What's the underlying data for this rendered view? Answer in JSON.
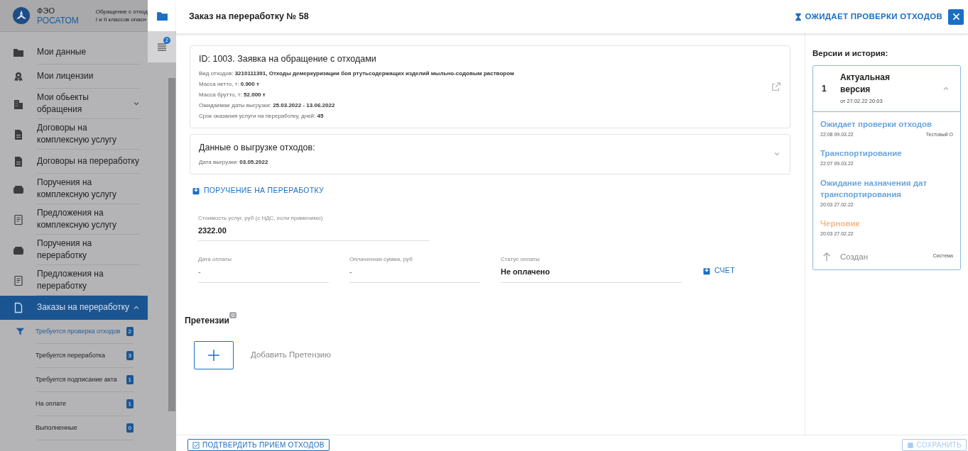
{
  "sidebar": {
    "brand": {
      "line1": "ФЭО",
      "line2": "РОСАТОМ"
    },
    "app_title": [
      "Обращение с отход",
      "I и II классов опасн"
    ],
    "items": [
      {
        "label": "Мои данные",
        "selected": false
      },
      {
        "label": "Мои лицензии",
        "selected": false
      },
      {
        "label": "Мои обьекты обращения",
        "selected": false,
        "expanded": false
      },
      {
        "label": "Договоры на комплексную услугу",
        "selected": false
      },
      {
        "label": "Договоры на переработку",
        "selected": false
      },
      {
        "label": "Поручения на комплексную услугу",
        "selected": false
      },
      {
        "label": "Предложения на комплексную услугу",
        "selected": false
      },
      {
        "label": "Поручения на переработку",
        "selected": false
      },
      {
        "label": "Предложения на переработку",
        "selected": false
      },
      {
        "label": "Заказы на переработку",
        "selected": true,
        "expanded": true,
        "children": [
          {
            "label": "Требуется проверка отходов",
            "count": "2",
            "selected": true
          },
          {
            "label": "Требуется переработка",
            "count": "3",
            "selected": false
          },
          {
            "label": "Требуется подписание акта",
            "count": "1",
            "selected": false
          },
          {
            "label": "На оплате",
            "count": "1",
            "selected": false
          },
          {
            "label": "Выполненные",
            "count": "0",
            "selected": false
          }
        ]
      }
    ]
  },
  "side_tabs": [
    {
      "kind": "folder",
      "selected": true
    },
    {
      "kind": "list",
      "badge": "2",
      "selected": false
    }
  ],
  "header": {
    "title": "Заказ на переработку № 58",
    "status": "ОЖИДАЕТ ПРОВЕРКИ ОТХОДОВ"
  },
  "request_card": {
    "title": "ID: 1003. Заявка на обращение с отходами",
    "lines": [
      "Вид отходов: **3210111391, Отходы демеркуризации боя ртутьсодержащих изделий мыльно-содовым раствором**",
      "Масса нетто, т: **0.900 т**",
      "Масса брутто, т: **52.000 т**",
      "Ожидаемае даты выгрузки: **25.03.2022 - 13.06.2022**",
      "Срок оказания услуги на переработку, дней: **45**"
    ]
  },
  "unload_card": {
    "title": "Данные о выгрузке отходов:",
    "line": "Дата выгрузки: **03.05.2022**",
    "expanded": false
  },
  "order_link": "ПОРУЧЕНИЕ НА ПЕРЕРАБОТКУ",
  "cost_field": {
    "label": "Стоимость услуг, руб (с НДС, если применимо)",
    "value": "2322.00"
  },
  "payment_fields": [
    {
      "label": "Дата оплаты",
      "value": "-"
    },
    {
      "label": "Оплаченная сумма, руб",
      "value": "-"
    },
    {
      "label": "Статус оплаты",
      "value": "Не оплачено"
    }
  ],
  "invoice_link": "СЧЕТ",
  "claims": {
    "title": "Претензии",
    "count": "0",
    "add_label": "Добавить Претензию"
  },
  "footer": {
    "confirm_button": "ПОДТВЕРДИТЬ ПРИЕМ ОТХОДОВ",
    "save_button": {
      "label": "СОХРАНИТЬ",
      "disabled": true
    }
  },
  "history": {
    "title": "Версии и история:",
    "version": {
      "number": "1",
      "title": "Актуальная версия",
      "date": "от 27.02.22 20:03",
      "expanded": true
    },
    "events": [
      {
        "kind": "status",
        "status": "Ожидает проверки отходов",
        "time": "22:08 09.03.22",
        "author": "Тестовый О",
        "color": "#6aa5dd"
      },
      {
        "kind": "status",
        "status": "Транспортирование",
        "time": "22:07 09.03.22",
        "color": "#6aa5dd"
      },
      {
        "kind": "status",
        "status": "Ожидание назначения дат транспортирования",
        "time": "20:03 27.02.22",
        "color": "#6aa5dd"
      },
      {
        "kind": "status",
        "status": "Черновик",
        "time": "20:03 27.02.22",
        "color": "#f8b98a"
      },
      {
        "kind": "created",
        "status": "Создан",
        "author": "Система"
      }
    ]
  }
}
